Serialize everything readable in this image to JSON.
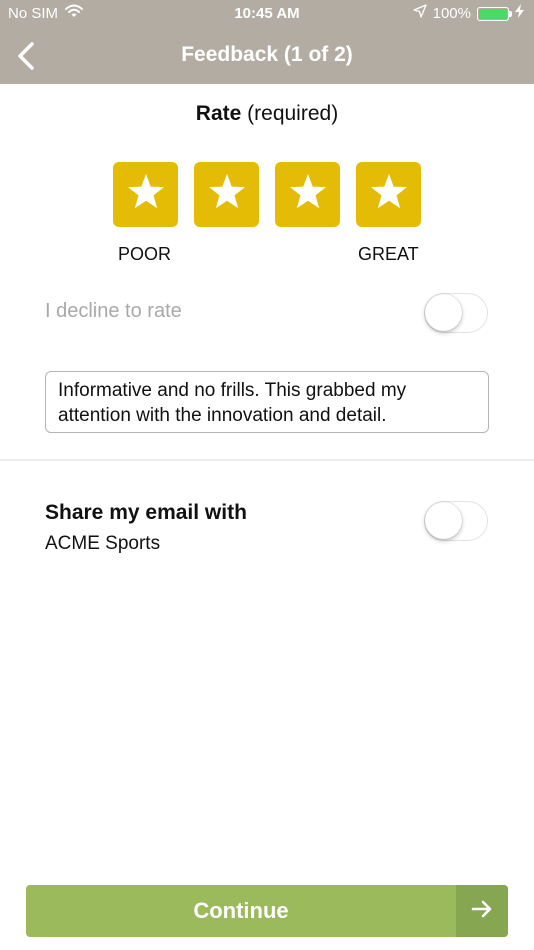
{
  "status_bar": {
    "carrier": "No SIM",
    "time": "10:45 AM",
    "battery_percent": "100%",
    "battery_level": 1.0,
    "battery_color": "#4cd964",
    "icons": [
      "wifi-icon",
      "location-arrow-icon",
      "battery-icon",
      "charging-bolt-icon"
    ]
  },
  "nav": {
    "title": "Feedback (1 of 2)",
    "back_icon": "chevron-left-icon",
    "bar_color": "#b2aca2"
  },
  "rating": {
    "title": "Rate",
    "required_text": "(required)",
    "stars_total": 4,
    "stars_selected": 4,
    "star_color": "#e4bc06",
    "star_icon": "star-icon",
    "low_label": "POOR",
    "high_label": "GREAT"
  },
  "decline": {
    "label": "I decline to rate",
    "enabled": false
  },
  "comment": {
    "value": "Informative and no frills. This grabbed my attention with the innovation and detail."
  },
  "share_email": {
    "title": "Share my email with",
    "organization": "ACME Sports",
    "enabled": false
  },
  "continue_button": {
    "label": "Continue",
    "color": "#9aba5c",
    "icon": "arrow-right-icon"
  }
}
